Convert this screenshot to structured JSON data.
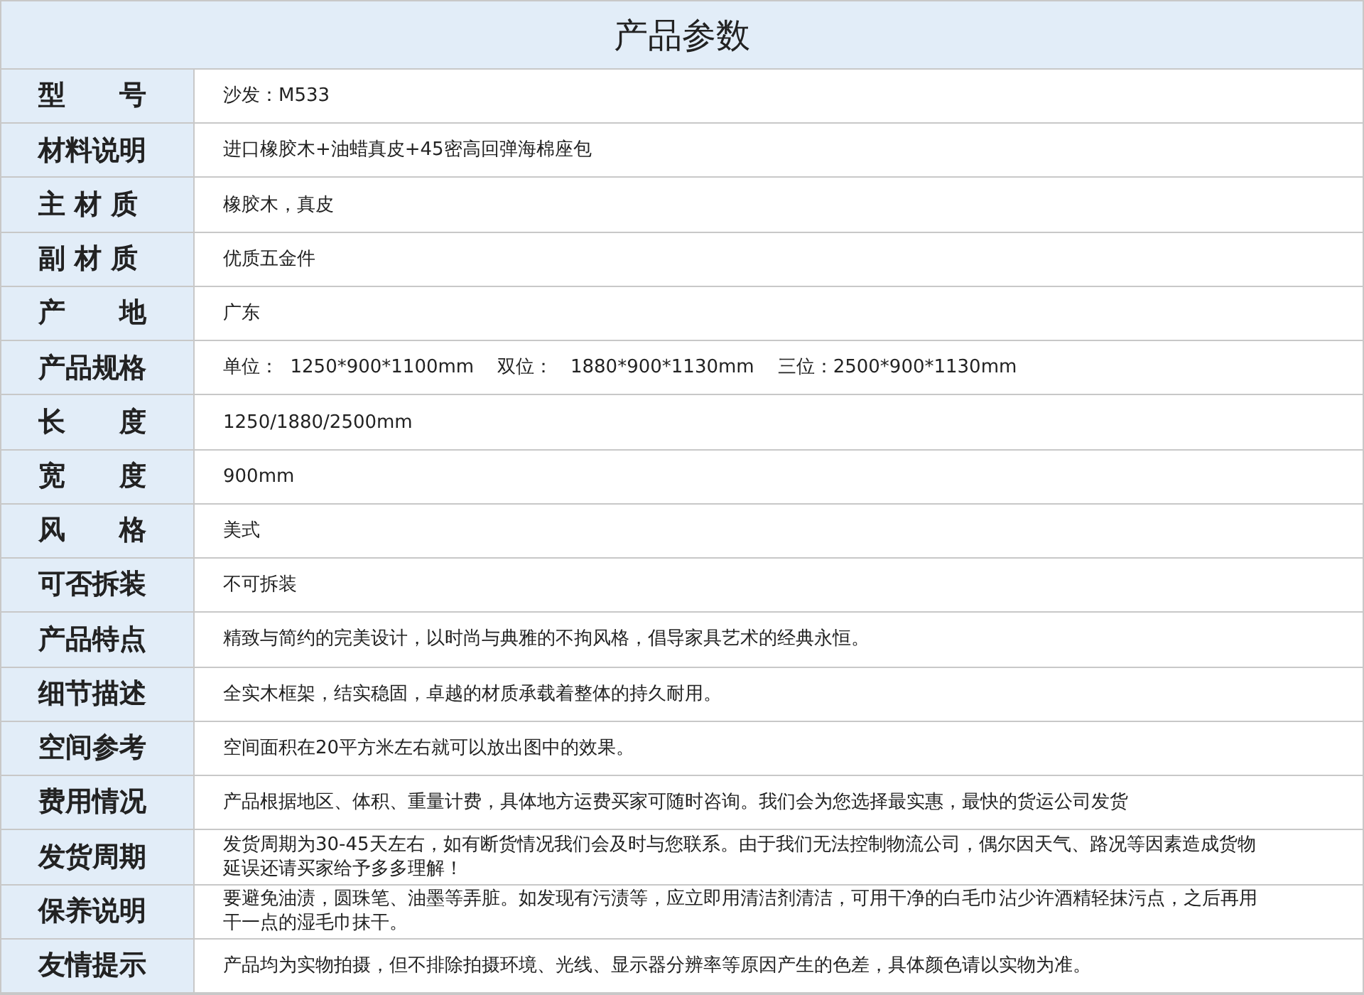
{
  "title": "产品参数",
  "rows": [
    {
      "label": "型　　号",
      "value": "沙发：M533"
    },
    {
      "label": "材料说明",
      "value": "进口橡胶木+油蜡真皮+45密高回弹海棉座包"
    },
    {
      "label": "主 材 质",
      "value": "橡胶木，真皮"
    },
    {
      "label": "副 材 质",
      "value": "优质五金件"
    },
    {
      "label": "产　　地",
      "value": "广东"
    },
    {
      "label": "产品规格",
      "value": "单位：  1250*900*1100mm    双位：   1880*900*1130mm    三位：2500*900*1130mm"
    },
    {
      "label": "长　　度",
      "value": "1250/1880/2500mm"
    },
    {
      "label": "宽　　度",
      "value": "900mm"
    },
    {
      "label": "风　　格",
      "value": "美式"
    },
    {
      "label": "可否拆装",
      "value": "不可拆装"
    },
    {
      "label": "产品特点",
      "value": "精致与简约的完美设计，以时尚与典雅的不拘风格，倡导家具艺术的经典永恒。"
    },
    {
      "label": "细节描述",
      "value": "全实木框架，结实稳固，卓越的材质承载着整体的持久耐用。"
    },
    {
      "label": "空间参考",
      "value": "空间面积在20平方米左右就可以放出图中的效果。"
    },
    {
      "label": "费用情况",
      "value": "产品根据地区、体积、重量计费，具体地方运费买家可随时咨询。我们会为您选择最实惠，最快的货运公司发货"
    },
    {
      "label": "发货周期",
      "value": "发货周期为30-45天左右，如有断货情况我们会及时与您联系。由于我们无法控制物流公司，偶尔因天气、路况等因素造成货物延误还请买家给予多多理解！"
    },
    {
      "label": "保养说明",
      "value": "要避免油渍，圆珠笔、油墨等弄脏。如发现有污渍等，应立即用清洁剂清洁，可用干净的白毛巾沾少许酒精轻抹污点，之后再用干一点的湿毛巾抹干。"
    },
    {
      "label": "友情提示",
      "value": "产品均为实物拍摄，但不排除拍摄环境、光线、显示器分辨率等原因产生的色差，具体颜色请以实物为准。"
    }
  ]
}
